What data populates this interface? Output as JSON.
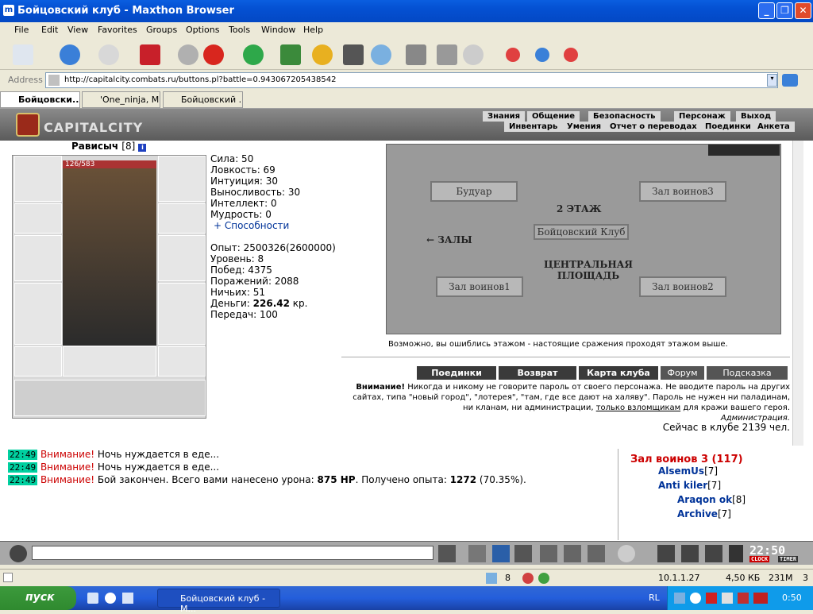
{
  "window": {
    "title": "Бойцовский клуб - Maxthon Browser"
  },
  "menu": [
    "File",
    "Edit",
    "View",
    "Favorites",
    "Groups",
    "Options",
    "Tools",
    "Window",
    "Help"
  ],
  "address": {
    "label": "Address",
    "url": "http://capitalcity.combats.ru/buttons.pl?battle=0.943067205438542"
  },
  "tabs": [
    "Бойцовски...",
    "'One_ninja, M...",
    "Бойцовский ..."
  ],
  "game": {
    "logo": "CAPITALCITY",
    "nav_top": [
      "Знания",
      "Общение",
      "Безопасность",
      "Персонаж",
      "Выход"
    ],
    "nav_sub": [
      "Инвентарь",
      "Умения",
      "Отчет о переводах",
      "Поединки",
      "Анкета"
    ],
    "character": {
      "name": "Рависыч",
      "level": "[8]",
      "hp": "126/583"
    },
    "stats": [
      "Сила: 50",
      "Ловкость: 69",
      "Интуиция: 30",
      "Выносливость: 30",
      "Интеллект: 0",
      "Мудрость: 0"
    ],
    "abilities": "+ Способности",
    "stats2": [
      "Опыт: 2500326(2600000)",
      "Уровень: 8",
      "Побед: 4375",
      "Поражений: 2088",
      "Ничьих: 51"
    ],
    "money_label": "Деньги: ",
    "money_value": "226.42",
    "money_unit": " кр.",
    "transfers": "Передач: 100",
    "map": {
      "rooms": [
        "Будуар",
        "Зал воинов3",
        "Зал воинов1",
        "Зал воинов2"
      ],
      "floor": "2 ЭТАЖ",
      "club": "Бойцовский Клуб",
      "halls": "← ЗАЛЫ",
      "central1": "ЦЕНТРАЛЬНАЯ",
      "central2": "ПЛОЩАДЬ"
    },
    "map_note": "Возможно, вы ошиблись этажом - настоящие сражения проходят этажом выше.",
    "buttons": [
      "Поединки",
      "Возврат",
      "Карта клуба",
      "Форум",
      "Подсказка"
    ],
    "warning_bold": "Внимание!",
    "warning_text": " Никогда и никому не говорите пароль от своего персонажа. Не вводите пароль на других сайтах, типа \"новый город\", \"лотерея\", \"там, где все дают на халяву\". Пароль не нужен ни паладинам, ни кланам, ни администрации, ",
    "warning_link": "только взломщикам",
    "warning_end": " для кражи вашего героя.",
    "admin": "Администрация.",
    "online": "Сейчас в клубе 2139 чел."
  },
  "chat": [
    {
      "time": "22:49",
      "label": "Внимание!",
      "text": " Ночь нуждается в еде..."
    },
    {
      "time": "22:49",
      "label": "Внимание!",
      "text": " Ночь нуждается в еде..."
    },
    {
      "time": "22:49",
      "label": "Внимание!",
      "text": " Бой закончен. Всего вами нанесено урона: ",
      "bold1": "875 HP",
      "mid": ". Получено опыта: ",
      "bold2": "1272",
      "tail": " (70.35%)."
    }
  ],
  "room": {
    "title": "Зал воинов 3 (117)",
    "users": [
      {
        "name": "AlsemUs",
        "level": "[7]"
      },
      {
        "name": "Anti kiler",
        "level": "[7]"
      },
      {
        "name": "Araqon ok",
        "level": "[8]"
      },
      {
        "name": "Archive",
        "level": "[7]"
      }
    ]
  },
  "clock": {
    "time": "22:50",
    "label1": "CLOCK",
    "label2": "TIMER"
  },
  "status": {
    "count": "8",
    "ip": "10.1.1.27",
    "size": "4,50 КБ",
    "mem": "231M",
    "n": "3"
  },
  "taskbar": {
    "start": "пуск",
    "task": "Бойцовский клуб - М...",
    "lang": "RL",
    "time": "0:50"
  }
}
